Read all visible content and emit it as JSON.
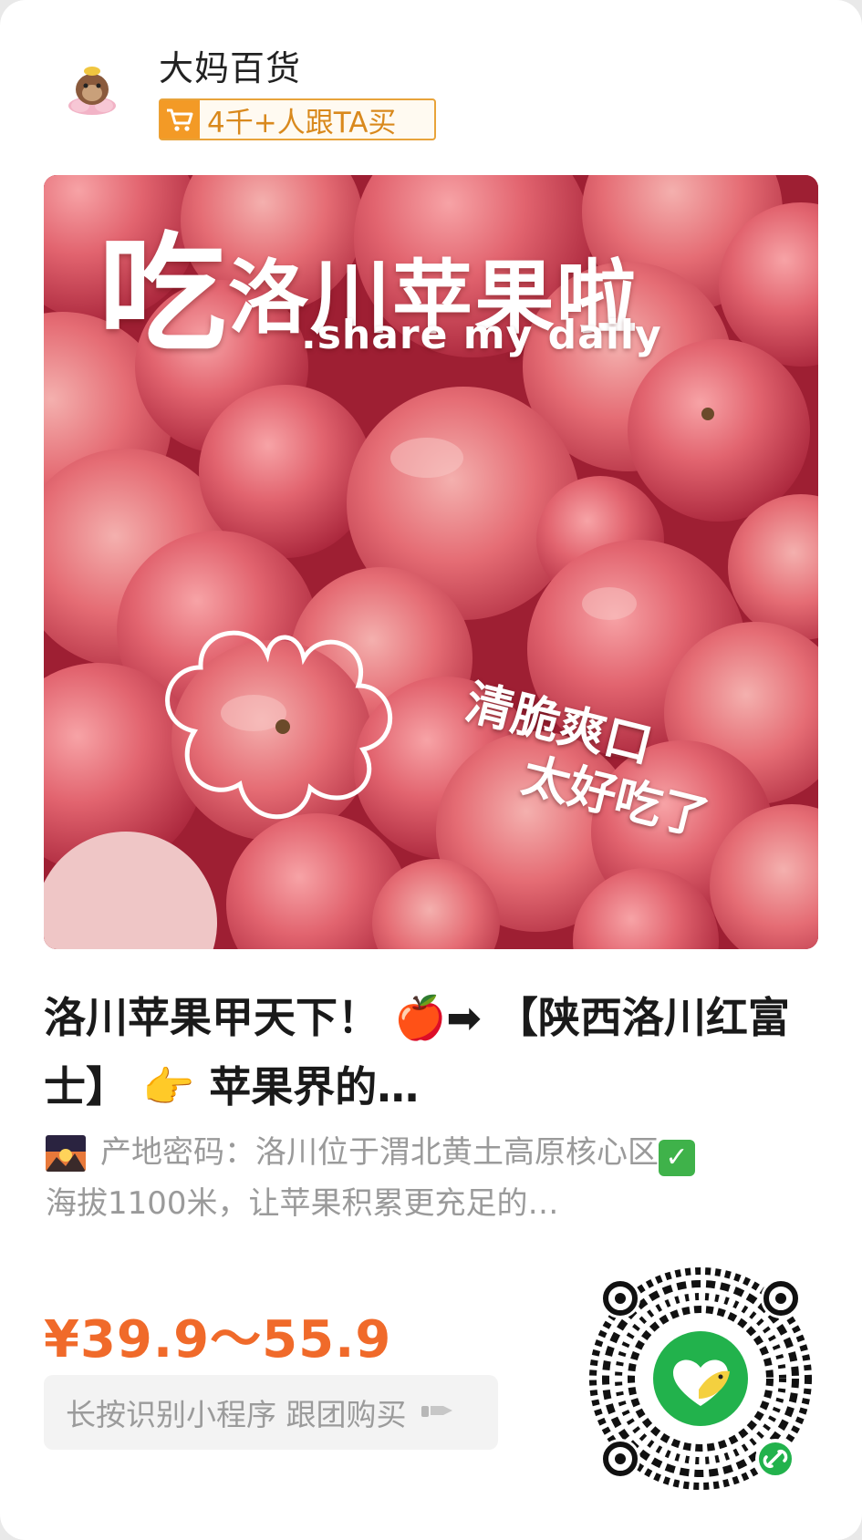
{
  "shop": {
    "name": "大妈百货",
    "buyers_badge": "4千+人跟TA买"
  },
  "hero": {
    "title_first": "吃",
    "title_rest": "洛川苹果啦",
    "subtitle": ".share my daily",
    "tag_line1": "清脆爽口",
    "tag_line2": "太好吃了"
  },
  "product": {
    "title": "洛川苹果甲天下！ 🍎➡ 【陕西洛川红富士】 👉 苹果界的…",
    "desc_part1": "产地密码：洛川位于渭北黄土高原核心区",
    "desc_part2": "海拔1100米，让苹果积累更充足的…",
    "price": "¥39.9～55.9"
  },
  "cta": {
    "label": "长按识别小程序 跟团购买"
  },
  "colors": {
    "price": "#f06a2a",
    "badge": "#f39a26",
    "qr_center": "#22b24c"
  }
}
